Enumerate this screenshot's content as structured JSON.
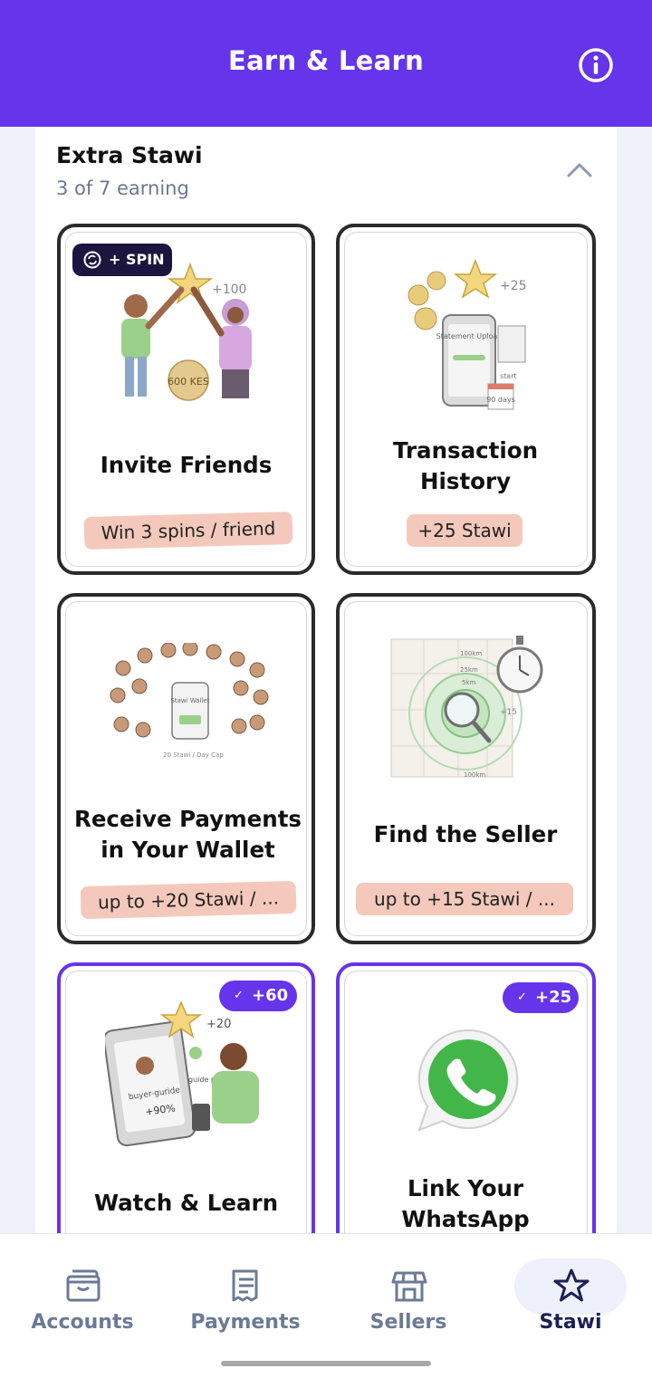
{
  "header": {
    "title": "Earn & Learn",
    "info_icon": "info-circle-icon"
  },
  "section": {
    "title": "Extra Stawi",
    "subtitle": "3 of 7 earning",
    "toggle_icon": "chevron-up-icon"
  },
  "cards": [
    {
      "title": "Invite Friends",
      "pill": "Win 3 spins / friend",
      "badge": "+ SPIN",
      "badge_icon": "spin-icon",
      "illustration_label": "+100",
      "illustration_bag_text": "600 KES"
    },
    {
      "title": "Transaction History",
      "pill": "+25 Stawi",
      "illustration_label": "+25",
      "illustration_phone_text": "Statement Upload",
      "illustration_side_text": "start",
      "illustration_calendar_text": "90 days"
    },
    {
      "title": "Receive Payments in Your Wallet",
      "pill": "up to +20 Stawi / ...",
      "illustration_phone_text": "Stawi Wallet",
      "illustration_caption": "20 Stawi / Day Cap"
    },
    {
      "title": "Find the Seller",
      "pill": "up to +15 Stawi / ...",
      "illustration_ring_labels": [
        "100km",
        "25km",
        "5km",
        "100km"
      ],
      "illustration_label": "+15"
    },
    {
      "title": "Watch & Learn",
      "badge": "+60",
      "illustration_label": "+20",
      "illustration_phone_text": "buyer-guride",
      "illustration_progress": "+90%",
      "illustration_check_text": "guide played"
    },
    {
      "title": "Link Your WhatsApp",
      "badge": "+25"
    }
  ],
  "colors": {
    "brand": "#6634ea",
    "pill": "#f4c9bb",
    "card_border": "#2b2b2b",
    "nav_active": "#1c2056"
  },
  "nav": [
    {
      "label": "Accounts",
      "icon": "wallet-icon"
    },
    {
      "label": "Payments",
      "icon": "receipt-icon"
    },
    {
      "label": "Sellers",
      "icon": "storefront-icon"
    },
    {
      "label": "Stawi",
      "icon": "star-icon",
      "active": true
    }
  ]
}
